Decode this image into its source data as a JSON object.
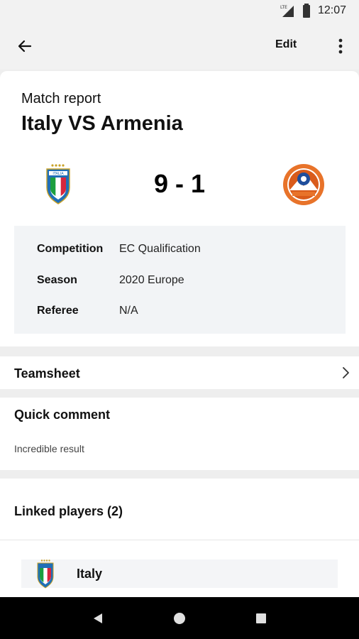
{
  "status_bar": {
    "time": "12:07",
    "network": "LTE"
  },
  "app_bar": {
    "back_icon": "arrow-left-icon",
    "edit_label": "Edit",
    "more_icon": "more-vert-icon"
  },
  "report": {
    "label": "Match report",
    "title": "Italy VS Armenia",
    "home_team": "Italy",
    "away_team": "Armenia",
    "score": "9 - 1",
    "details": [
      {
        "key": "Competition",
        "value": "EC Qualification"
      },
      {
        "key": "Season",
        "value": "2020 Europe"
      },
      {
        "key": "Referee",
        "value": "N/A"
      }
    ]
  },
  "teamsheet": {
    "label": "Teamsheet"
  },
  "quick_comment": {
    "title": "Quick comment",
    "text": "Incredible result"
  },
  "linked_players": {
    "title": "Linked players (2)",
    "items": [
      {
        "name": "Italy"
      }
    ]
  },
  "colors": {
    "italy_blue": "#1f6fb7",
    "armenia_orange": "#e8732a",
    "armenia_blue": "#1f4e9c",
    "nav_bar": "#000000"
  }
}
